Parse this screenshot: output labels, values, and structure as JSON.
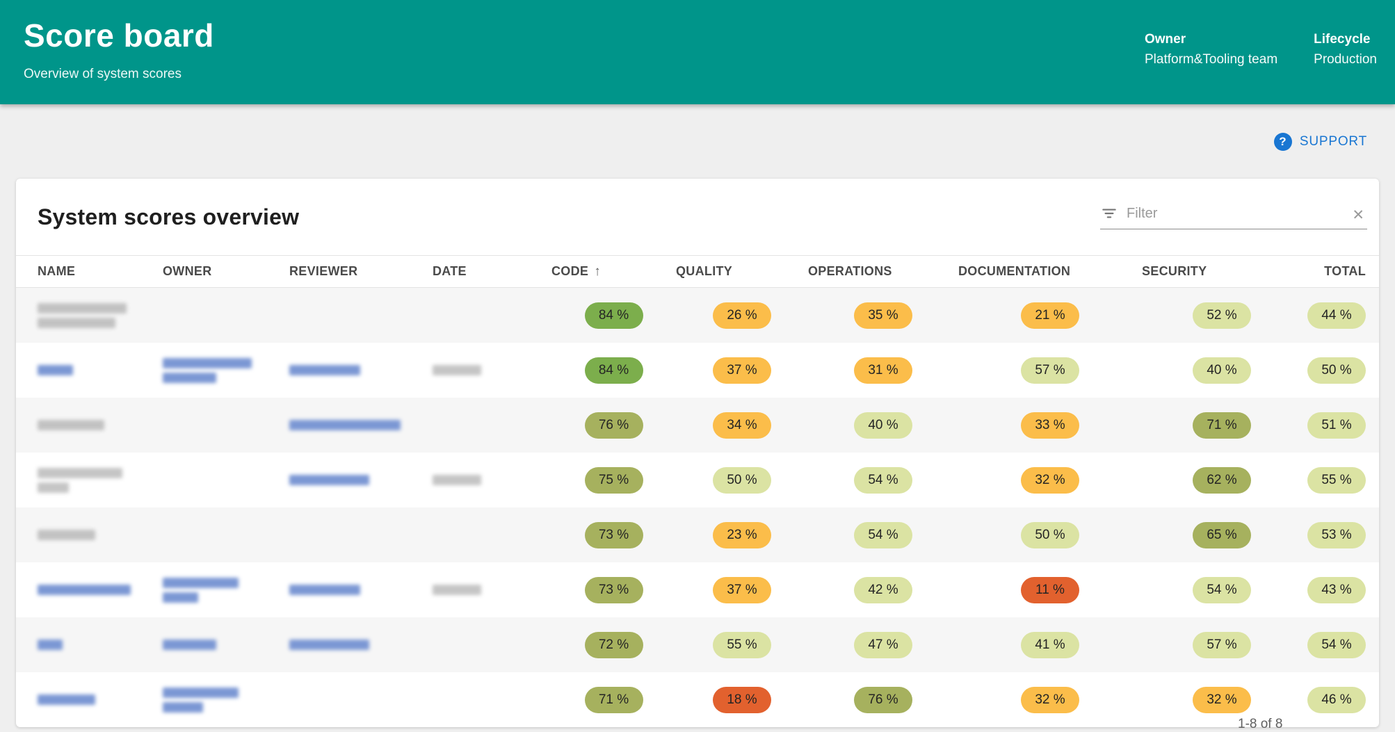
{
  "header": {
    "title": "Score board",
    "subtitle": "Overview of system scores",
    "meta": [
      {
        "label": "Owner",
        "value": "Platform&Tooling team"
      },
      {
        "label": "Lifecycle",
        "value": "Production"
      }
    ]
  },
  "support": {
    "label": "SUPPORT",
    "icon": "help-circle-icon"
  },
  "card": {
    "title": "System scores overview",
    "filter_placeholder": "Filter",
    "filter_value": ""
  },
  "table": {
    "columns": [
      "NAME",
      "OWNER",
      "REVIEWER",
      "DATE",
      "CODE",
      "QUALITY",
      "OPERATIONS",
      "DOCUMENTATION",
      "SECURITY",
      "TOTAL"
    ],
    "sorted_column": "CODE",
    "sort_direction": "ascending",
    "sort_icon": "arrow-up-icon",
    "rows": [
      {
        "name": {
          "style": "plain",
          "lines": [
            128,
            112
          ]
        },
        "owner": null,
        "reviewer": null,
        "date": null,
        "scores": {
          "code": 84,
          "quality": 26,
          "operations": 35,
          "documentation": 21,
          "security": 52,
          "total": 44
        }
      },
      {
        "name": {
          "style": "link",
          "lines": [
            51
          ]
        },
        "owner": {
          "style": "link",
          "lines": [
            128,
            77
          ]
        },
        "reviewer": {
          "style": "link",
          "lines": [
            102
          ]
        },
        "date": {
          "style": "plain",
          "lines": [
            70
          ]
        },
        "scores": {
          "code": 84,
          "quality": 37,
          "operations": 31,
          "documentation": 57,
          "security": 40,
          "total": 50
        }
      },
      {
        "name": {
          "style": "plain",
          "lines": [
            96
          ]
        },
        "owner": null,
        "reviewer": {
          "style": "link",
          "lines": [
            160
          ]
        },
        "date": null,
        "scores": {
          "code": 76,
          "quality": 34,
          "operations": 40,
          "documentation": 33,
          "security": 71,
          "total": 51
        }
      },
      {
        "name": {
          "style": "plain",
          "lines": [
            122,
            45
          ]
        },
        "owner": null,
        "reviewer": {
          "style": "link",
          "lines": [
            115
          ]
        },
        "date": {
          "style": "plain",
          "lines": [
            70
          ]
        },
        "scores": {
          "code": 75,
          "quality": 50,
          "operations": 54,
          "documentation": 32,
          "security": 62,
          "total": 55
        }
      },
      {
        "name": {
          "style": "plain",
          "lines": [
            83
          ]
        },
        "owner": null,
        "reviewer": null,
        "date": null,
        "scores": {
          "code": 73,
          "quality": 23,
          "operations": 54,
          "documentation": 50,
          "security": 65,
          "total": 53
        }
      },
      {
        "name": {
          "style": "link",
          "lines": [
            134
          ]
        },
        "owner": {
          "style": "link",
          "lines": [
            109,
            51
          ]
        },
        "reviewer": {
          "style": "link",
          "lines": [
            102
          ]
        },
        "date": {
          "style": "plain",
          "lines": [
            70
          ]
        },
        "scores": {
          "code": 73,
          "quality": 37,
          "operations": 42,
          "documentation": 11,
          "security": 54,
          "total": 43
        }
      },
      {
        "name": {
          "style": "link",
          "lines": [
            36
          ]
        },
        "owner": {
          "style": "link",
          "lines": [
            77
          ]
        },
        "reviewer": {
          "style": "link",
          "lines": [
            115
          ]
        },
        "date": null,
        "scores": {
          "code": 72,
          "quality": 55,
          "operations": 47,
          "documentation": 41,
          "security": 57,
          "total": 54
        }
      },
      {
        "name": {
          "style": "link",
          "lines": [
            83
          ]
        },
        "owner": {
          "style": "link",
          "lines": [
            109,
            58
          ]
        },
        "reviewer": null,
        "date": null,
        "scores": {
          "code": 71,
          "quality": 18,
          "operations": 76,
          "documentation": 32,
          "security": 32,
          "total": 46
        }
      }
    ]
  },
  "paginator": {
    "range_label": "1-8 of 8"
  },
  "colors": {
    "teal_header": "#00958A",
    "link_blue": "#1976D2",
    "score_high": "#7CAE4C",
    "score_good": "#A6B15E",
    "score_mid": "#DBE3A3",
    "score_low": "#FBBD4A",
    "score_critical": "#E2612E"
  },
  "score_thresholds": [
    {
      "min": 80,
      "class": "high"
    },
    {
      "min": 60,
      "class": "good"
    },
    {
      "min": 40,
      "class": "mid"
    },
    {
      "min": 20,
      "class": "low"
    },
    {
      "min": 0,
      "class": "critical"
    }
  ]
}
